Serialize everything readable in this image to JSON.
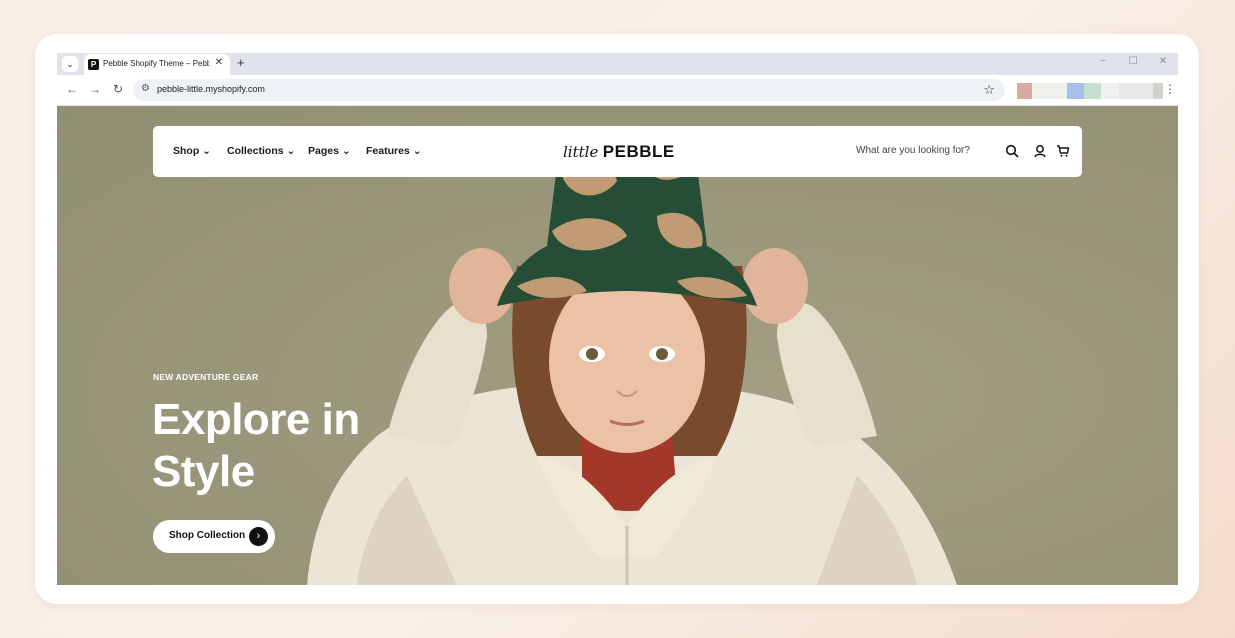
{
  "browser": {
    "tab_title": "Pebble Shopify Theme – Pebble",
    "tab_favicon": "P",
    "tab_close": "✕",
    "new_tab": "+",
    "url": "pebble-little.myshopify.com",
    "window_controls": [
      "−",
      "☐",
      "✕"
    ]
  },
  "store": {
    "nav": [
      {
        "label": "Shop"
      },
      {
        "label": "Collections"
      },
      {
        "label": "Pages"
      },
      {
        "label": "Features"
      }
    ],
    "logo_script": "little",
    "logo_main": "PEBBLE",
    "search_placeholder": "What are you looking for?",
    "icons": [
      "search-icon",
      "account-icon",
      "cart-icon"
    ]
  },
  "hero": {
    "eyebrow": "NEW ADVENTURE GEAR",
    "headline_line1": "Explore in",
    "headline_line2": "Style",
    "cta_label": "Shop Collection",
    "cta_arrow": "›"
  },
  "colors": {
    "hero_bg": "#99967a",
    "tab_strip": "#dfe3ea",
    "page_bg": "#f6eee9"
  }
}
